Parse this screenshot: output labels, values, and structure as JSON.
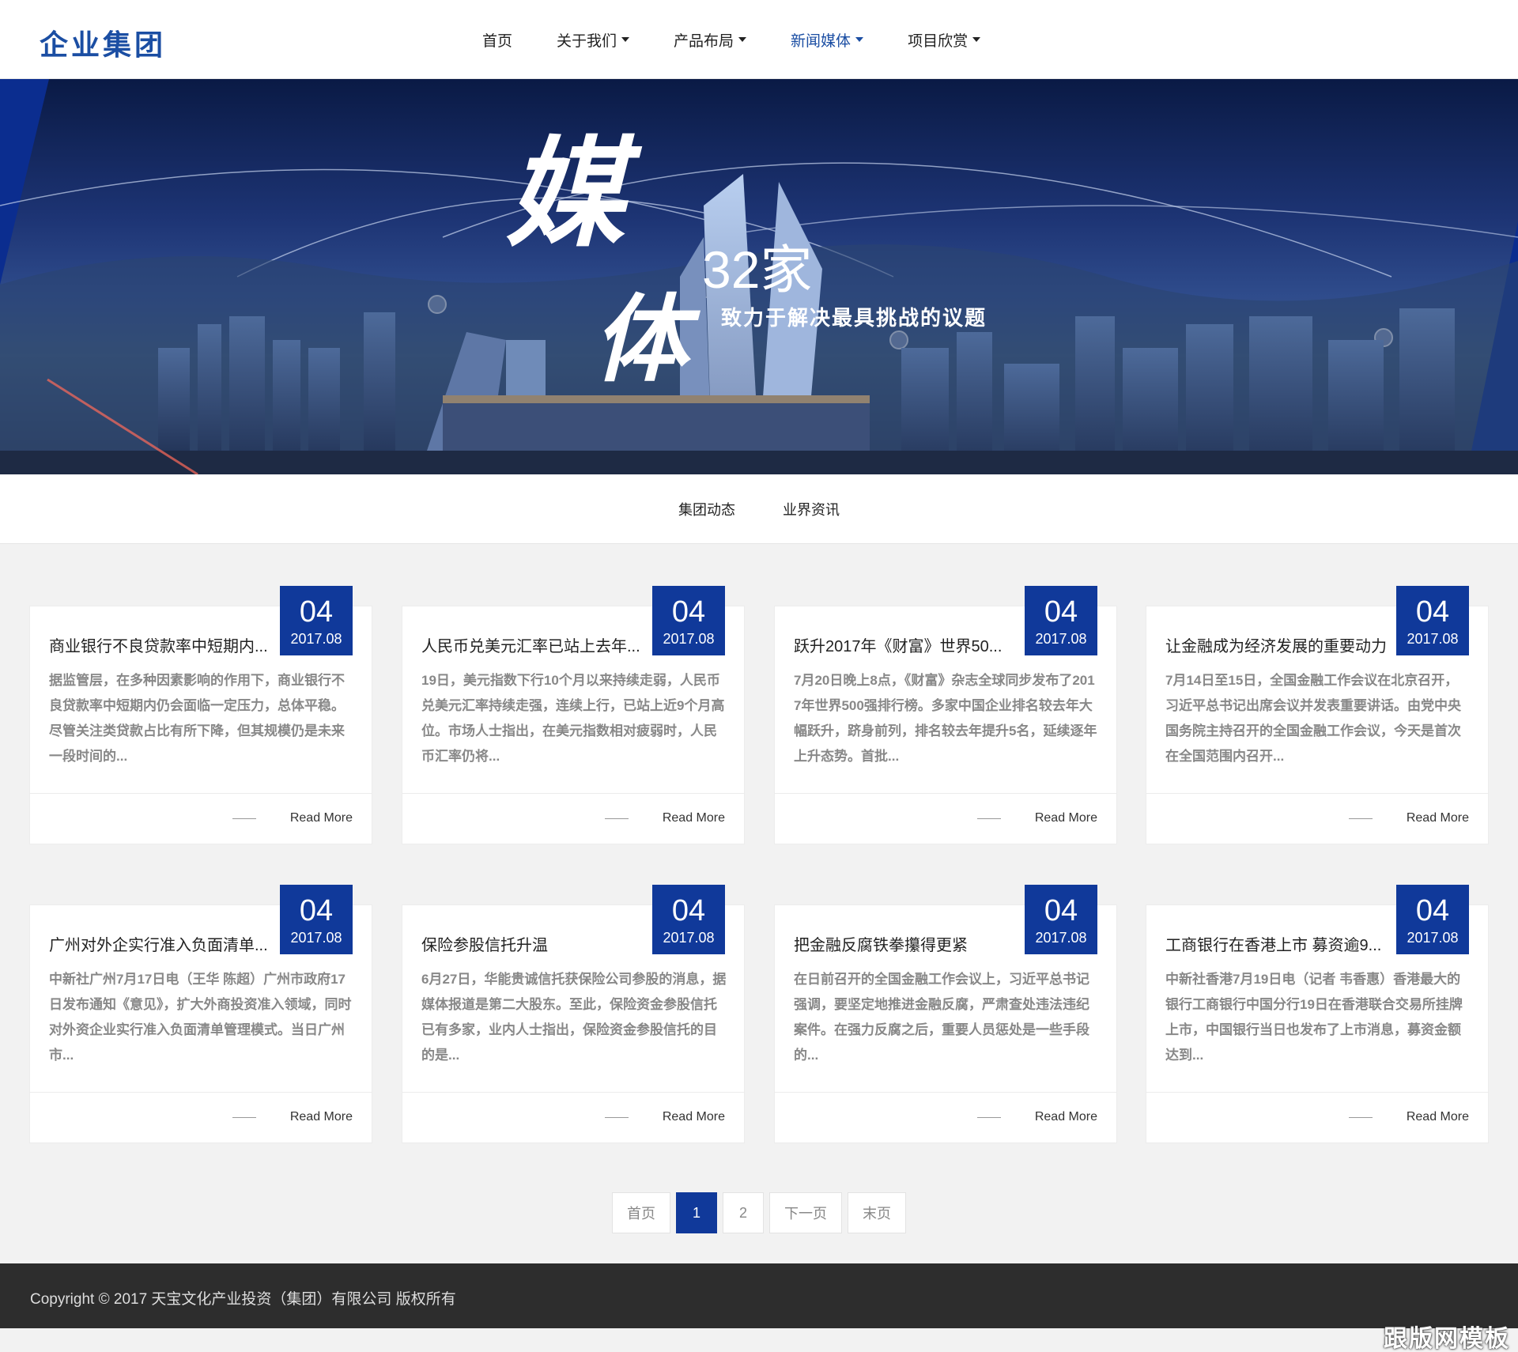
{
  "header": {
    "logo": "企业集团",
    "nav": [
      {
        "label": "首页",
        "dropdown": false,
        "active": false
      },
      {
        "label": "关于我们",
        "dropdown": true,
        "active": false
      },
      {
        "label": "产品布局",
        "dropdown": true,
        "active": false
      },
      {
        "label": "新闻媒体",
        "dropdown": true,
        "active": true
      },
      {
        "label": "项目欣赏",
        "dropdown": true,
        "active": false
      }
    ]
  },
  "banner": {
    "char1": "媒",
    "char2": "体",
    "count": "32家",
    "subtitle": "致力于解决最具挑战的议题"
  },
  "subnav": {
    "items": [
      "集团动态",
      "业界资讯"
    ]
  },
  "articles": [
    {
      "day": "04",
      "ym": "2017.08",
      "title": "商业银行不良贷款率中短期内...",
      "desc": "据监管层，在多种因素影响的作用下，商业银行不良贷款率中短期内仍会面临一定压力，总体平稳。尽管关注类贷款占比有所下降，但其规模仍是未来一段时间的...",
      "more": "Read More"
    },
    {
      "day": "04",
      "ym": "2017.08",
      "title": "人民币兑美元汇率已站上去年...",
      "desc": "19日，美元指数下行10个月以来持续走弱，人民币兑美元汇率持续走强，连续上行，已站上近9个月高位。市场人士指出，在美元指数相对疲弱时，人民币汇率仍将...",
      "more": "Read More"
    },
    {
      "day": "04",
      "ym": "2017.08",
      "title": "跃升2017年《财富》世界50...",
      "desc": "7月20日晚上8点，《财富》杂志全球同步发布了2017年世界500强排行榜。多家中国企业排名较去年大幅跃升，跻身前列，排名较去年提升5名，延续逐年上升态势。首批...",
      "more": "Read More"
    },
    {
      "day": "04",
      "ym": "2017.08",
      "title": "让金融成为经济发展的重要动力",
      "desc": "7月14日至15日，全国金融工作会议在北京召开，习近平总书记出席会议并发表重要讲话。由党中央国务院主持召开的全国金融工作会议，今天是首次在全国范围内召开...",
      "more": "Read More"
    },
    {
      "day": "04",
      "ym": "2017.08",
      "title": "广州对外企实行准入负面清单...",
      "desc": "中新社广州7月17日电（王华 陈超）广州市政府17日发布通知《意见》，扩大外商投资准入领域，同时对外资企业实行准入负面清单管理模式。当日广州市...",
      "more": "Read More"
    },
    {
      "day": "04",
      "ym": "2017.08",
      "title": "保险参股信托升温",
      "desc": "6月27日，华能贵诚信托获保险公司参股的消息，据媒体报道是第二大股东。至此，保险资金参股信托已有多家，业内人士指出，保险资金参股信托的目的是...",
      "more": "Read More"
    },
    {
      "day": "04",
      "ym": "2017.08",
      "title": "把金融反腐铁拳攥得更紧",
      "desc": "在日前召开的全国金融工作会议上，习近平总书记强调，要坚定地推进金融反腐，严肃查处违法违纪案件。在强力反腐之后，重要人员惩处是一些手段的...",
      "more": "Read More"
    },
    {
      "day": "04",
      "ym": "2017.08",
      "title": "工商银行在香港上市 募资逾9...",
      "desc": "中新社香港7月19日电（记者 韦香惠）香港最大的银行工商银行中国分行19日在香港联合交易所挂牌上市，中国银行当日也发布了上市消息，募资金额达到...",
      "more": "Read More"
    }
  ],
  "pagination": {
    "first": "首页",
    "pages": [
      "1",
      "2"
    ],
    "current": "1",
    "next": "下一页",
    "last": "末页"
  },
  "footer": {
    "copyright": "Copyright © 2017 天宝文化产业投资（集团）有限公司 版权所有"
  },
  "watermark": "跟版网模板",
  "colors": {
    "brand": "#10399a",
    "logo": "#1b4ea3",
    "footer_bg": "#2d2d2d"
  }
}
